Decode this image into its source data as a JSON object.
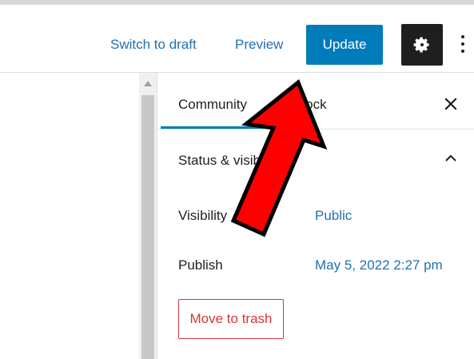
{
  "header": {
    "switch_to_draft_label": "Switch to draft",
    "preview_label": "Preview",
    "update_label": "Update",
    "settings_icon": "gear-icon",
    "options_icon": "vertical-ellipsis-icon"
  },
  "sidebar": {
    "tabs": [
      {
        "label": "Community",
        "active": true
      },
      {
        "label": "Block",
        "active": false
      }
    ],
    "close_icon": "close-icon",
    "panel": {
      "title": "Status & visibility",
      "expanded": true,
      "rows": [
        {
          "label": "Visibility",
          "value": "Public"
        },
        {
          "label": "Publish",
          "value": "May 5, 2022 2:27 pm"
        }
      ],
      "trash_label": "Move to trash"
    }
  },
  "colors": {
    "accent": "#007cba",
    "link": "#2271b1",
    "danger": "#d63638",
    "annotation_arrow": "#ff0000"
  }
}
